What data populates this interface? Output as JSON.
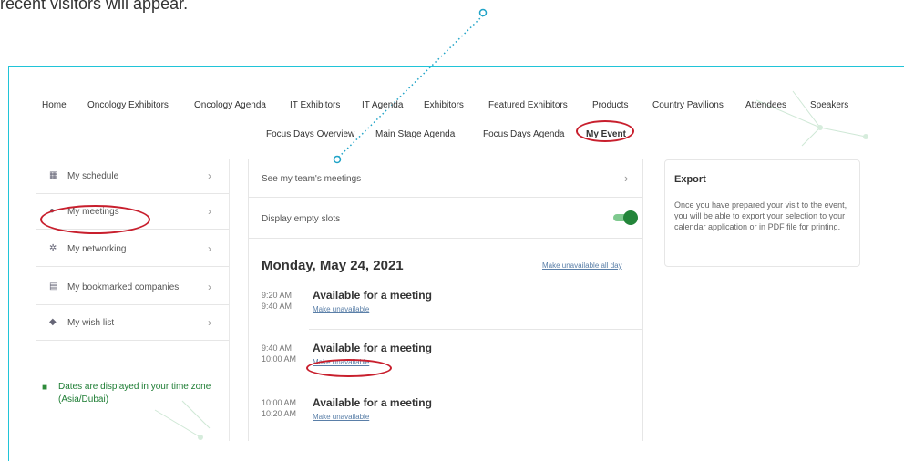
{
  "intro_text": "recent visitors will appear.",
  "nav": {
    "row1": [
      "Home",
      "Oncology Exhibitors",
      "Oncology Agenda",
      "IT Exhibitors",
      "IT Agenda",
      "Exhibitors",
      "Featured Exhibitors",
      "Products",
      "Country Pavilions",
      "Attendees",
      "Speakers"
    ],
    "row2": [
      "Focus Days Overview",
      "Main Stage Agenda",
      "Focus Days Agenda",
      "My Event"
    ]
  },
  "sidebar": {
    "items": [
      {
        "label": "My schedule",
        "icon": "calendar-icon"
      },
      {
        "label": "My meetings",
        "icon": "meeting-icon"
      },
      {
        "label": "My networking",
        "icon": "people-icon"
      },
      {
        "label": "My bookmarked companies",
        "icon": "bookmark-icon"
      },
      {
        "label": "My wish list",
        "icon": "wishlist-icon"
      }
    ],
    "timezone_note": "Dates are displayed in your time zone (Asia/Dubai)"
  },
  "main": {
    "team_meetings_label": "See my team's meetings",
    "empty_slots_label": "Display empty slots",
    "empty_slots_on": true,
    "date_heading": "Monday, May 24, 2021",
    "make_unavailable_all": "Make unavailable all day",
    "slots": [
      {
        "start": "9:20 AM",
        "end": "9:40 AM",
        "title": "Available for a meeting",
        "action": "Make unavailable"
      },
      {
        "start": "9:40 AM",
        "end": "10:00 AM",
        "title": "Available for a meeting",
        "action": "Make unavailable"
      },
      {
        "start": "10:00 AM",
        "end": "10:20 AM",
        "title": "Available for a meeting",
        "action": "Make unavailable"
      }
    ]
  },
  "export": {
    "title": "Export",
    "description": "Once you have prepared your visit to the event, you will be able to export your selection to your calendar application or in PDF file for printing."
  },
  "colors": {
    "accent_frame": "#20c4d8",
    "highlight_ring": "#c81f2d",
    "toggle_on": "#23853a",
    "timezone_text": "#1e7d34"
  }
}
